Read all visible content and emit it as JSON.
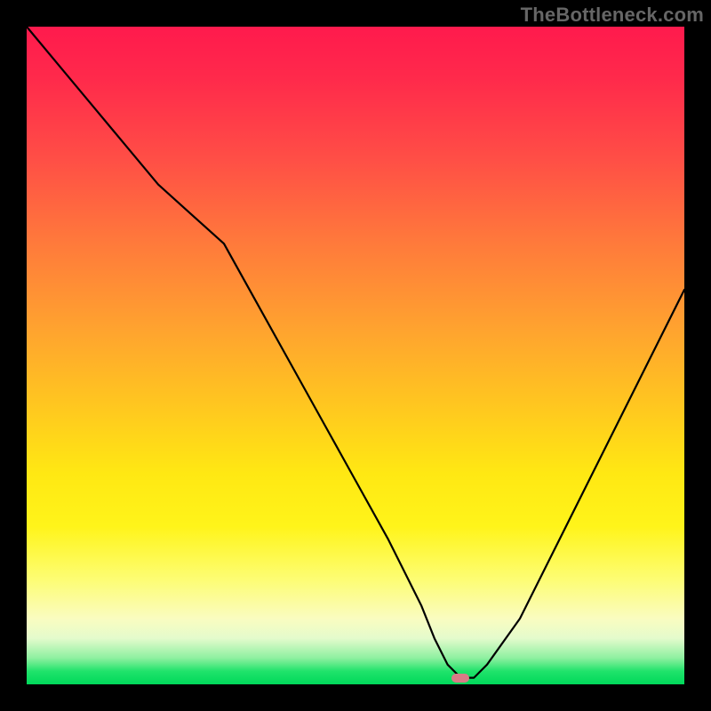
{
  "watermark": "TheBottleneck.com",
  "colors": {
    "background": "#000000",
    "curve": "#000000",
    "marker": "#d97b86",
    "gradient_top": "#ff1a4d",
    "gradient_bottom": "#00d85a"
  },
  "chart_data": {
    "type": "line",
    "title": "",
    "xlabel": "",
    "ylabel": "",
    "xlim": [
      0,
      100
    ],
    "ylim": [
      0,
      100
    ],
    "grid": false,
    "x": [
      0,
      5,
      10,
      15,
      20,
      25,
      30,
      35,
      40,
      45,
      50,
      55,
      60,
      62,
      64,
      66,
      68,
      70,
      75,
      80,
      85,
      90,
      95,
      100
    ],
    "y": [
      100,
      94,
      88,
      82,
      76,
      71.5,
      67,
      58,
      49,
      40,
      31,
      22,
      12,
      7,
      3,
      1,
      1,
      3,
      10,
      20,
      30,
      40,
      50,
      60
    ],
    "series": [
      {
        "name": "bottleneck_curve",
        "x_ref": "x",
        "y_ref": "y"
      }
    ],
    "marker": {
      "x": 66,
      "y": 1
    },
    "annotations": []
  }
}
